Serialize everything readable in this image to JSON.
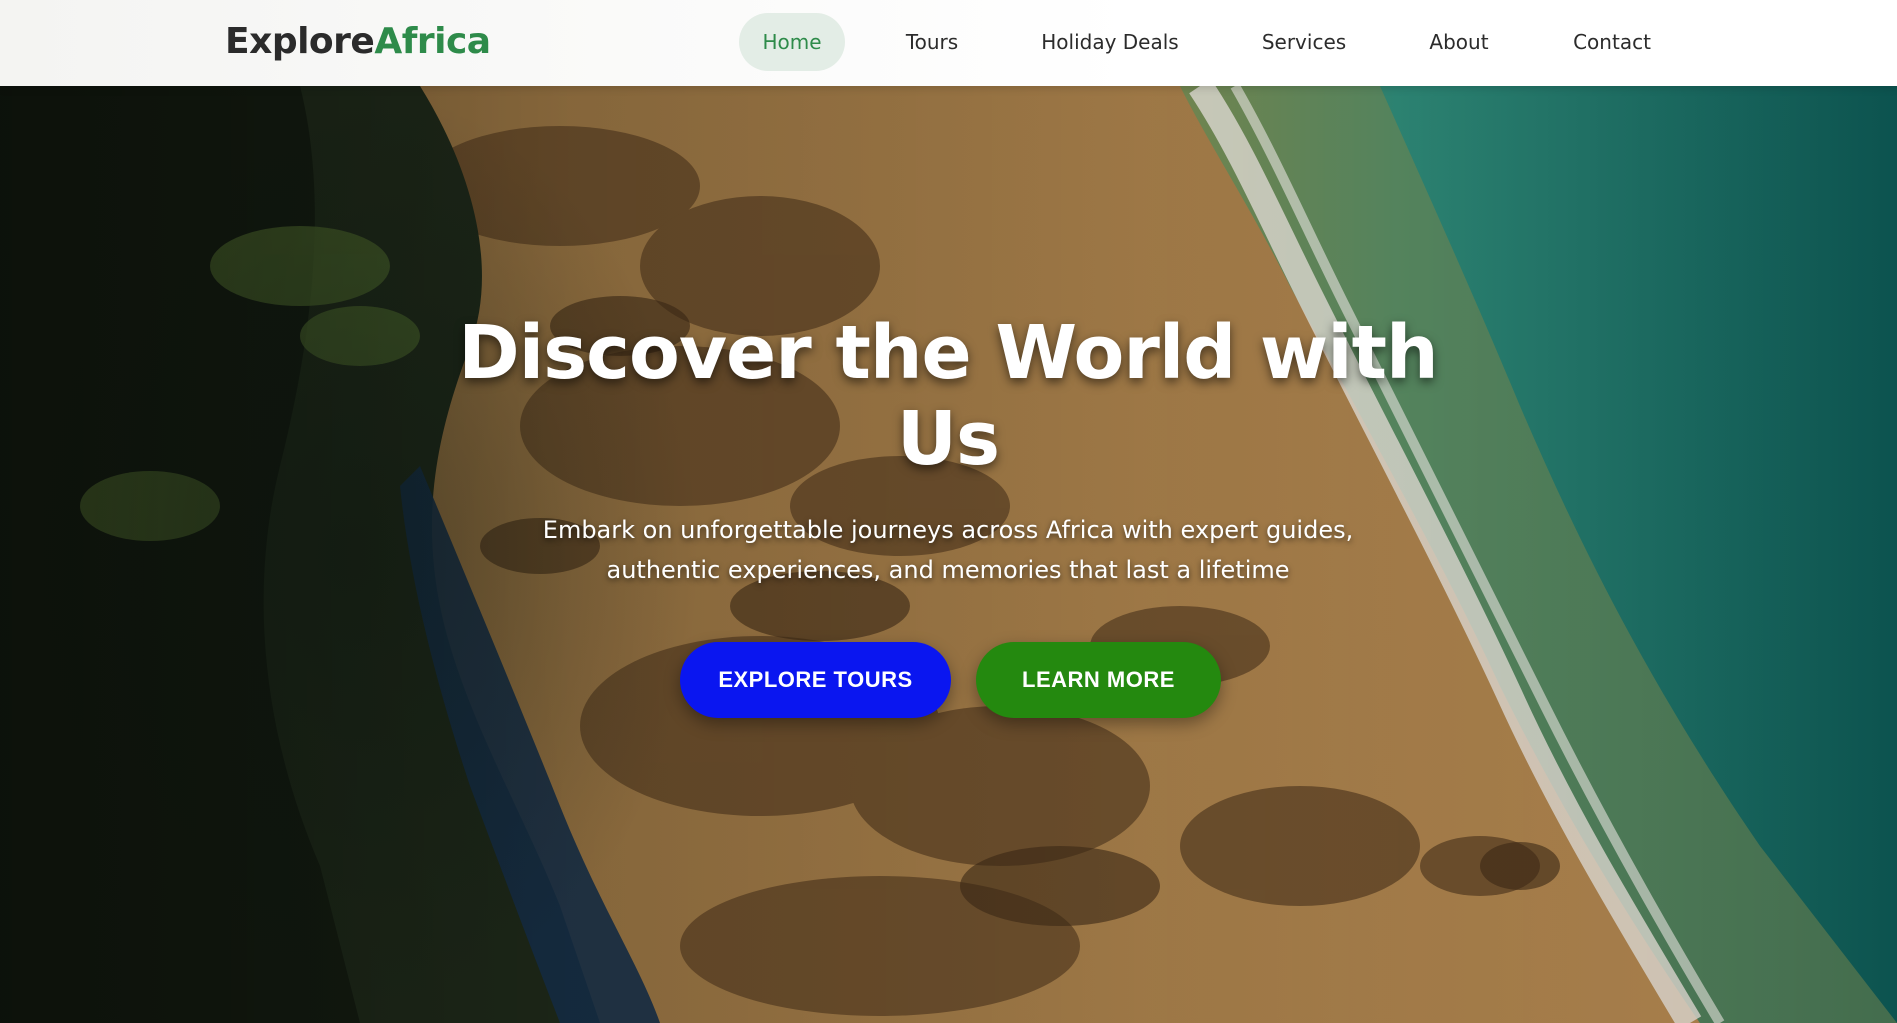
{
  "header": {
    "logo_part1": "Explore",
    "logo_part2": "Africa",
    "nav": [
      {
        "label": "Home",
        "active": true
      },
      {
        "label": "Tours",
        "active": false
      },
      {
        "label": "Holiday Deals",
        "active": false
      },
      {
        "label": "Services",
        "active": false
      },
      {
        "label": "About",
        "active": false
      },
      {
        "label": "Contact",
        "active": false
      }
    ]
  },
  "hero": {
    "title": "Discover the World with Us",
    "subtitle": "Embark on unforgettable journeys across Africa with expert guides, authentic experiences, and memories that last a lifetime",
    "primary_button": "EXPLORE TOURS",
    "secondary_button": "LEARN MORE",
    "background_image": "aerial-coastline-photo"
  },
  "colors": {
    "brand_green": "#2e8b4a",
    "primary_button": "#0a16f0",
    "secondary_button": "#24890f",
    "nav_active_bg": "#e3ede6"
  }
}
